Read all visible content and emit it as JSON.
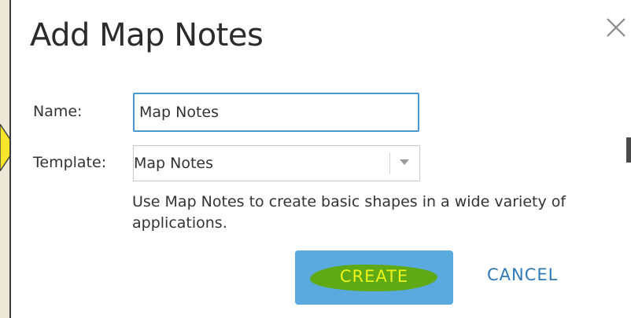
{
  "dialog": {
    "title": "Add Map Notes",
    "close_icon": "close-icon"
  },
  "form": {
    "name_label": "Name:",
    "name_value": "Map Notes",
    "template_label": "Template:",
    "template_value": "Map Notes",
    "template_icon": "chevron-down-icon",
    "description": "Use Map Notes to create basic shapes in a wide variety of applications."
  },
  "actions": {
    "create_label": "CREATE",
    "cancel_label": "CANCEL"
  },
  "colors": {
    "accent_blue": "#5aa9df",
    "input_border": "#4a98d3",
    "link_blue": "#2e7ab8",
    "highlight_green": "#5ea914",
    "highlight_text": "#ecf41c",
    "callout_yellow": "#f5e62a"
  }
}
